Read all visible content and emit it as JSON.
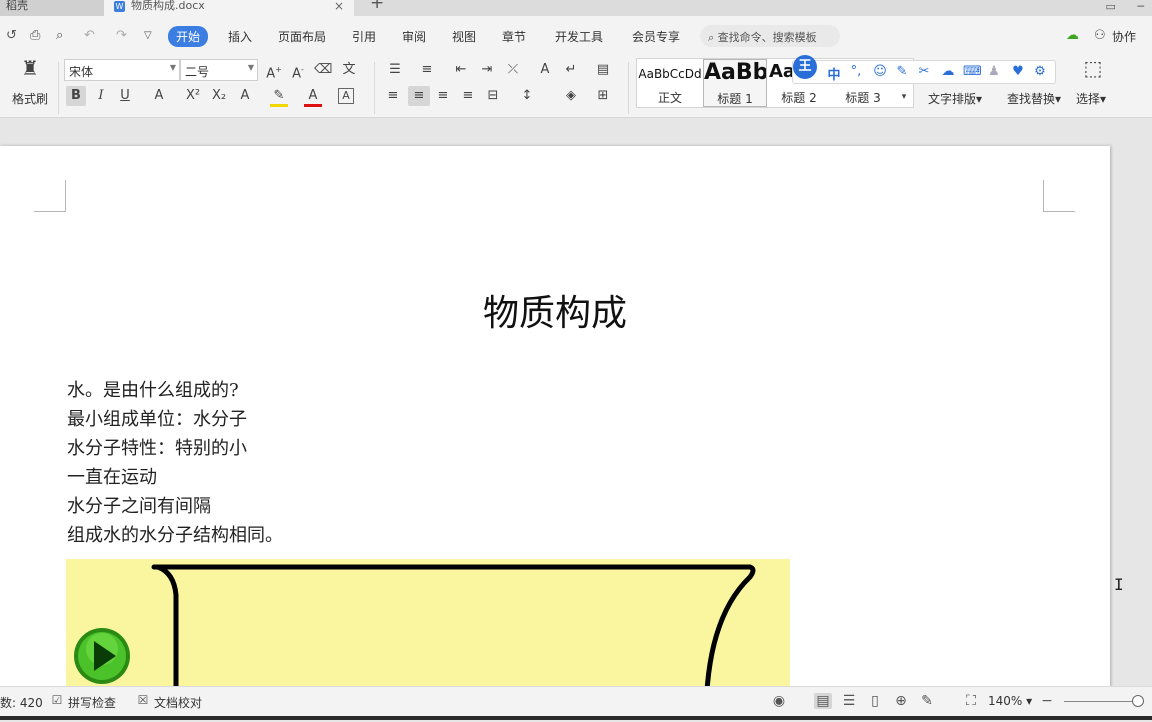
{
  "tabs": {
    "first": "稻壳",
    "doc": "物质构成.docx",
    "doc_icon": "W",
    "close": "×",
    "plus": "+"
  },
  "quick_access": [
    "undo-style-icon",
    "print-icon",
    "print-preview-icon",
    "undo-icon",
    "redo-icon",
    "more-icon"
  ],
  "menu": {
    "items": [
      "开始",
      "插入",
      "页面布局",
      "引用",
      "审阅",
      "视图",
      "章节",
      "开发工具",
      "会员专享"
    ],
    "active": "开始",
    "search_placeholder": "查找命令、搜索模板",
    "collab": "协作"
  },
  "ribbon": {
    "format_painter": "格式刷",
    "font_name": "宋体",
    "font_size": "二号",
    "styles": [
      {
        "preview": "AaBbCcDd",
        "label": "正文"
      },
      {
        "preview": "AaBb",
        "label": "标题 1"
      },
      {
        "preview": "AaB",
        "label": "标题 2"
      },
      {
        "preview": "",
        "label": "标题 3"
      }
    ],
    "text_layout": "文字排版",
    "find_replace": "查找替换",
    "select": "选择",
    "float_badge": "王",
    "float_zh": "中"
  },
  "document": {
    "title": "物质构成",
    "paragraphs": [
      "水。是由什么组成的?",
      "最小组成单位：水分子",
      "水分子特性：特别的小",
      "一直在运动",
      "水分子之间有间隔",
      "组成水的水分子结构相同。"
    ]
  },
  "status": {
    "word_count": "数: 420",
    "spell_check": "拼写检查",
    "doc_proof": "文档校对",
    "zoom": "140%"
  },
  "colors": {
    "accent": "#3b7de0",
    "picture_bg": "#faf6a0",
    "play_button": "#3aa51f"
  }
}
